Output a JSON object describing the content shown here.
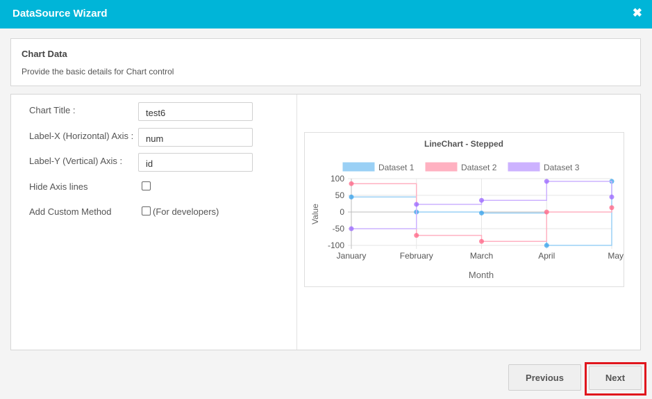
{
  "window": {
    "title": "DataSource Wizard",
    "close_glyph": "✖"
  },
  "info": {
    "heading": "Chart Data",
    "description": "Provide the basic details for Chart control"
  },
  "form": {
    "chart_title_label": "Chart Title :",
    "chart_title_value": "test6",
    "label_x_label": "Label-X (Horizontal) Axis :",
    "label_x_value": "num",
    "label_y_label": "Label-Y (Vertical) Axis :",
    "label_y_value": "id",
    "hide_axis_label": "Hide Axis lines",
    "hide_axis_checked": false,
    "custom_method_label": "Add Custom Method",
    "custom_method_checked": false,
    "custom_method_note": "(For developers)"
  },
  "chart_data": {
    "type": "line",
    "stepped": true,
    "title": "LineChart - Stepped",
    "xlabel": "Month",
    "ylabel": "Value",
    "categories": [
      "January",
      "February",
      "March",
      "April",
      "May"
    ],
    "ylim": [
      -100,
      100
    ],
    "yticks": [
      100,
      50,
      0,
      -50,
      -100
    ],
    "legend_position": "top",
    "grid": true,
    "series": [
      {
        "name": "Dataset 1",
        "values": [
          45,
          0,
          -3,
          -100,
          92
        ],
        "color": "#36a2eb",
        "fill": "#9ad0f5"
      },
      {
        "name": "Dataset 2",
        "values": [
          85,
          -70,
          -88,
          0,
          13
        ],
        "color": "#ff6384",
        "fill": "#ffb1c1"
      },
      {
        "name": "Dataset 3",
        "values": [
          -50,
          23,
          35,
          92,
          45
        ],
        "color": "#9966ff",
        "fill": "#ccb2ff"
      }
    ]
  },
  "buttons": {
    "previous": "Previous",
    "next": "Next"
  },
  "highlight_color": "#e0161d"
}
